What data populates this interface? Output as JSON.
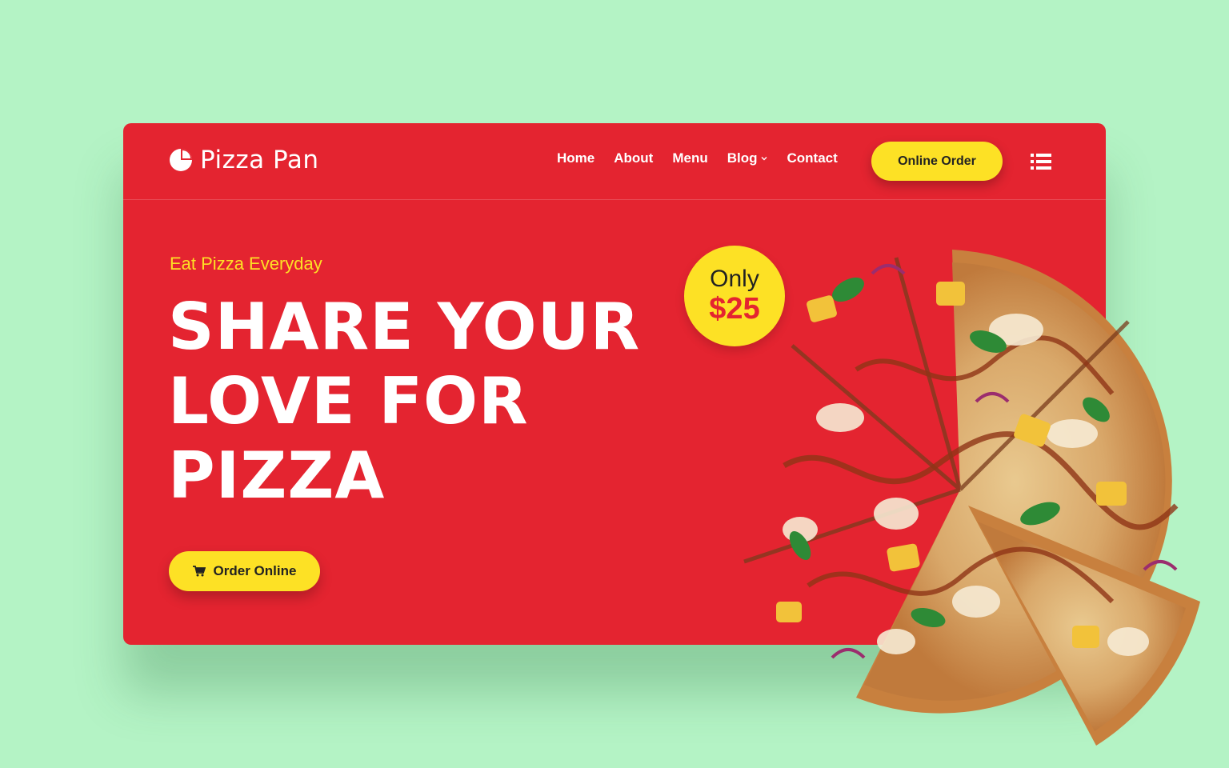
{
  "brand": {
    "name": "Pizza Pan",
    "logo_icon": "pizza-slice-icon"
  },
  "nav": {
    "links": [
      "Home",
      "About",
      "Menu",
      "Blog",
      "Contact"
    ],
    "cta_label": "Online Order",
    "menu_icon": "list-menu-icon"
  },
  "hero": {
    "tagline": "Eat Pizza Everyday",
    "headline_lines": [
      "SHARE YOUR",
      "LOVE FOR",
      "PIZZA"
    ],
    "button_label": "Order Online",
    "button_icon": "cart-icon"
  },
  "badge": {
    "line1": "Only",
    "price": "$25"
  },
  "colors": {
    "background": "#b4f3c5",
    "brand_red": "#e42430",
    "accent_yellow": "#fde125",
    "text_dark": "#222222"
  }
}
